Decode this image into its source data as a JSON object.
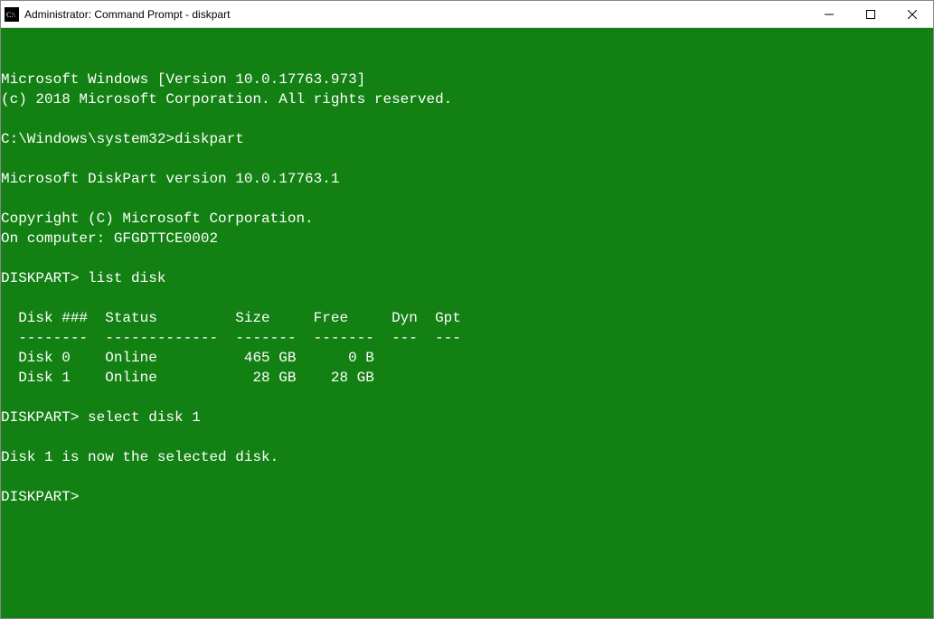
{
  "window": {
    "title": "Administrator: Command Prompt - diskpart"
  },
  "terminal": {
    "lines": {
      "l0": "Microsoft Windows [Version 10.0.17763.973]",
      "l1": "(c) 2018 Microsoft Corporation. All rights reserved.",
      "l2": "",
      "l3": "C:\\Windows\\system32>diskpart",
      "l4": "",
      "l5": "Microsoft DiskPart version 10.0.17763.1",
      "l6": "",
      "l7": "Copyright (C) Microsoft Corporation.",
      "l8": "On computer: GFGDTTCE0002",
      "l9": "",
      "l10": "DISKPART> list disk",
      "l11": "",
      "l12": "  Disk ###  Status         Size     Free     Dyn  Gpt",
      "l13": "  --------  -------------  -------  -------  ---  ---",
      "l14": "  Disk 0    Online          465 GB      0 B",
      "l15": "  Disk 1    Online           28 GB    28 GB",
      "l16": "",
      "l17": "DISKPART> select disk 1",
      "l18": "",
      "l19": "Disk 1 is now the selected disk.",
      "l20": "",
      "l21": "DISKPART>"
    }
  }
}
